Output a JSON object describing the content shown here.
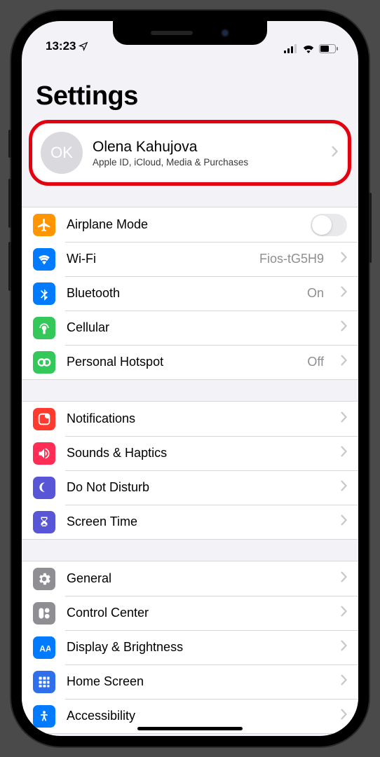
{
  "status": {
    "time": "13:23"
  },
  "header": {
    "title": "Settings"
  },
  "profile": {
    "initials": "OK",
    "name": "Olena Kahujova",
    "subtitle": "Apple ID, iCloud, Media & Purchases"
  },
  "group1": {
    "airplane": {
      "label": "Airplane Mode"
    },
    "wifi": {
      "label": "Wi-Fi",
      "value": "Fios-tG5H9"
    },
    "bluetooth": {
      "label": "Bluetooth",
      "value": "On"
    },
    "cellular": {
      "label": "Cellular"
    },
    "hotspot": {
      "label": "Personal Hotspot",
      "value": "Off"
    }
  },
  "group2": {
    "notifications": {
      "label": "Notifications"
    },
    "sounds": {
      "label": "Sounds & Haptics"
    },
    "dnd": {
      "label": "Do Not Disturb"
    },
    "screentime": {
      "label": "Screen Time"
    }
  },
  "group3": {
    "general": {
      "label": "General"
    },
    "controlcenter": {
      "label": "Control Center"
    },
    "display": {
      "label": "Display & Brightness"
    },
    "homescreen": {
      "label": "Home Screen"
    },
    "accessibility": {
      "label": "Accessibility"
    }
  }
}
